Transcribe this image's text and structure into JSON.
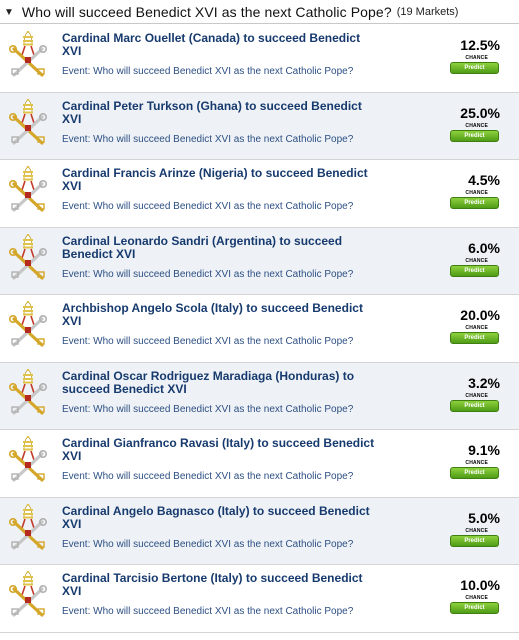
{
  "header": {
    "title": "Who will succeed Benedict XVI as the next Catholic Pope?",
    "count": "(19 Markets)"
  },
  "event_label": "Event:",
  "event_name": "Who will succeed Benedict XVI as the next Catholic Pope?",
  "chance_label": "CHANCE",
  "predict_label": "Predict",
  "markets": [
    {
      "title": "Cardinal Marc Ouellet (Canada) to succeed Benedict XVI",
      "percent": "12.5%"
    },
    {
      "title": "Cardinal Peter Turkson (Ghana) to succeed Benedict XVI",
      "percent": "25.0%"
    },
    {
      "title": "Cardinal Francis Arinze (Nigeria) to succeed Benedict XVI",
      "percent": "4.5%"
    },
    {
      "title": "Cardinal Leonardo Sandri (Argentina) to succeed Benedict XVI",
      "percent": "6.0%"
    },
    {
      "title": "Archbishop Angelo Scola (Italy) to succeed Benedict XVI",
      "percent": "20.0%"
    },
    {
      "title": "Cardinal Oscar Rodriguez Maradiaga (Honduras) to succeed Benedict XVI",
      "percent": "3.2%"
    },
    {
      "title": "Cardinal Gianfranco Ravasi (Italy) to succeed Benedict XVI",
      "percent": "9.1%"
    },
    {
      "title": "Cardinal Angelo Bagnasco (Italy) to succeed Benedict XVI",
      "percent": "5.0%"
    },
    {
      "title": "Cardinal Tarcisio Bertone (Italy) to succeed Benedict XVI",
      "percent": "10.0%"
    }
  ],
  "colors": {
    "title_blue": "#173a6e",
    "row_alt": "#eef2f6",
    "predict_green": "#5aa71b"
  }
}
